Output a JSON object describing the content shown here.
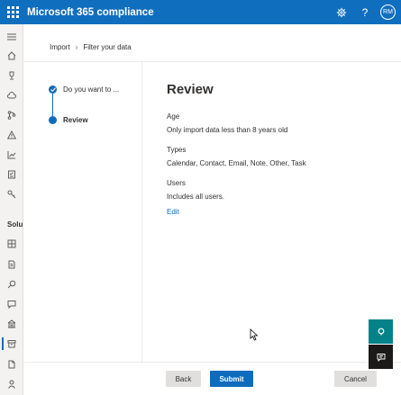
{
  "header": {
    "app_title": "Microsoft 365 compliance",
    "avatar_initials": "RM",
    "settings_icon": "gear-icon",
    "help_icon": "help-icon"
  },
  "leftnav": {
    "section_label": "Solu",
    "icons": [
      "menu-icon",
      "home-icon",
      "trophy-icon",
      "cloud-icon",
      "flow-icon",
      "alert-icon",
      "chart-icon",
      "checklist-icon",
      "key-icon",
      "catalog-icon",
      "document-icon",
      "search-icon",
      "chat-icon",
      "building-icon",
      "archive-icon",
      "file-icon",
      "person-icon"
    ]
  },
  "breadcrumb": {
    "items": [
      "Import",
      "Filter your data"
    ]
  },
  "steps": [
    {
      "label": "Do you want to ...",
      "state": "completed"
    },
    {
      "label": "Review",
      "state": "current"
    }
  ],
  "review": {
    "title": "Review",
    "age": {
      "label": "Age",
      "value": "Only import data less than 8 years old"
    },
    "types": {
      "label": "Types",
      "value": "Calendar, Contact, Email, Note, Other, Task"
    },
    "users": {
      "label": "Users",
      "value": "Includes all users."
    },
    "edit_label": "Edit"
  },
  "footer": {
    "back_label": "Back",
    "submit_label": "Submit",
    "cancel_label": "Cancel"
  },
  "colors": {
    "brand": "#0f6cbd",
    "teal": "#038387",
    "dark": "#1b1a19"
  }
}
